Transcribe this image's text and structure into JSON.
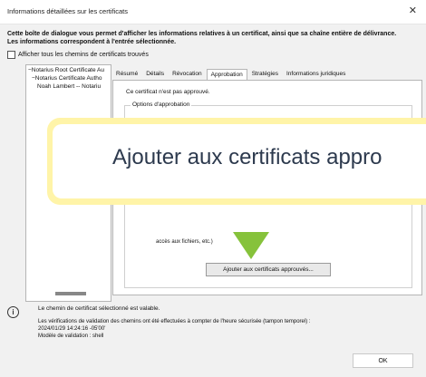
{
  "window": {
    "title": "Informations détaillées sur les certificats"
  },
  "description": "Cette boîte de dialogue vous permet d'afficher les informations relatives à un certificat, ainsi que sa chaîne entière de délivrance. Les informations correspondent à l'entrée sélectionnée.",
  "show_all_paths_label": "Afficher tous les chemins de certificats trouvés",
  "tree": [
    "Notarius Root Certificate Au",
    "Notarius Certificate Autho",
    "Noah Lambert -- Notariu"
  ],
  "tabs": [
    "Résumé",
    "Détails",
    "Révocation",
    "Approbation",
    "Stratégies",
    "Informations juridiques"
  ],
  "active_tab": "Approbation",
  "approval_panel": {
    "status_text": "Ce certificat n'est pas approuvé.",
    "options_label": "Options d'approbation",
    "partial_text": "accès aux fichiers, etc.)",
    "approve_button": "Ajouter aux certificats approuvés..."
  },
  "callout": {
    "text": "Ajouter aux certificats appro",
    "accent": "#86c23b",
    "border": "#fff4a8"
  },
  "status": {
    "title": "Le chemin de certificat sélectionné est valable.",
    "line1": "Les vérifications de validation des chemins ont été effectuées à compter de l'heure sécurisée (tampon temporel) :",
    "line2": "2024/01/29 14:24:16 -05'00'",
    "line3": "Modèle de validation : shell"
  },
  "ok_label": "OK"
}
